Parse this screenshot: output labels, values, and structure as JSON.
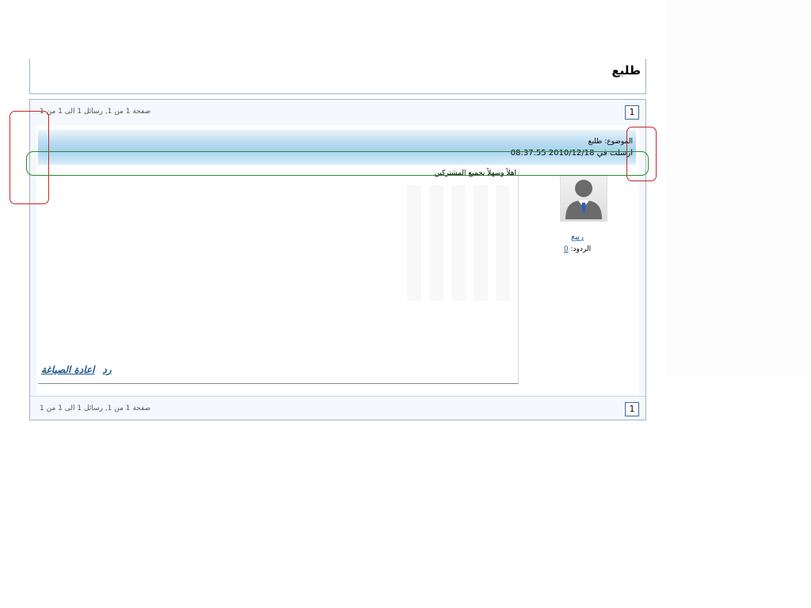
{
  "title": "طلبع",
  "pagination": {
    "current_page": "1",
    "info": "صفحة 1 من 1, رسائل 1 الى 1 من 1"
  },
  "post": {
    "topic_label": "الموضوع:",
    "topic_value": "طلبع",
    "date_prefix": "ارسلت في",
    "date_value": "2010/12/18 08:37:55",
    "greeting": "اهلاً وسهلاً بجميع المشتركين",
    "actions": {
      "quote_label": "اعادة الصياغة",
      "reply_label": "رد"
    },
    "author": {
      "avatar_icon": "user-avatar-icon",
      "name": "ربيع",
      "replies_label": "الردود:",
      "replies_value": "0"
    }
  },
  "annotation_colors": {
    "red": "#c0282a",
    "green": "#2a8a2a"
  }
}
